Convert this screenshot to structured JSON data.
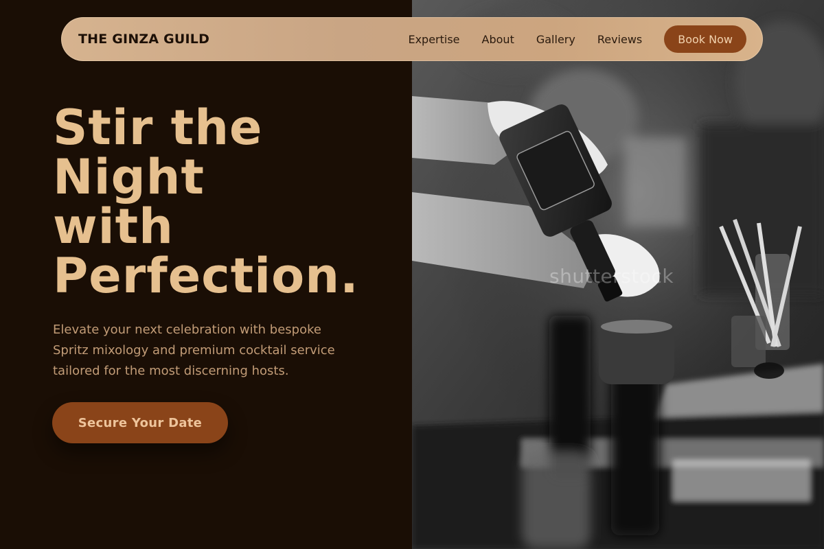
{
  "brand": {
    "name": "THE GINZA GUILD"
  },
  "nav": {
    "links": [
      "Expertise",
      "About",
      "Gallery",
      "Reviews"
    ],
    "cta_label": "Book Now"
  },
  "hero": {
    "headline_lines": [
      "Stir the",
      "Night",
      "with",
      "Perfection."
    ],
    "subtext": "Elevate your next celebration with bespoke Spritz mixology and premium cocktail service tailored for the most discerning hosts.",
    "cta_label": "Secure Your Date",
    "photo_watermark": "shutterstock"
  },
  "colors": {
    "background": "#1a0e05",
    "accent": "#8a4419",
    "headline": "#e6c08f",
    "nav_bar": "#cfa985"
  }
}
